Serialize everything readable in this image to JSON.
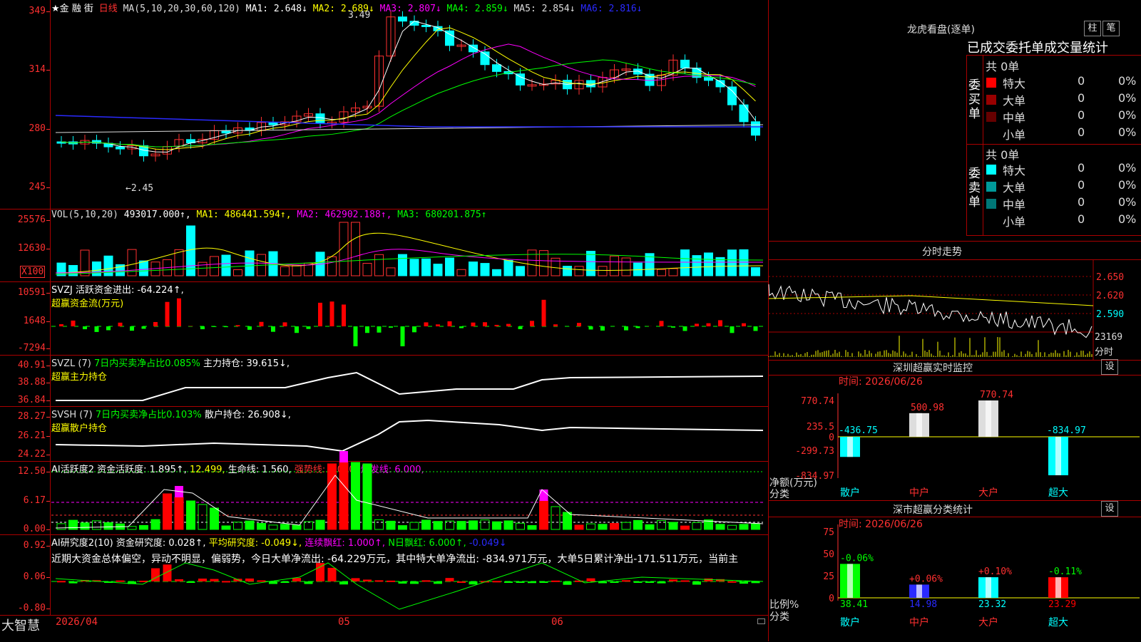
{
  "kline": {
    "stock_name": "★金 融 街",
    "period": "日线",
    "ma_label": "MA(5,10,20,30,60,120)",
    "ma": [
      {
        "label": "MA1: 2.648↓",
        "color": "#ffffff"
      },
      {
        "label": "MA2: 2.689↓",
        "color": "#ffff00"
      },
      {
        "label": "MA3: 2.807↓",
        "color": "#ff00ff"
      },
      {
        "label": "MA4: 2.859↓",
        "color": "#00ff00"
      },
      {
        "label": "MA5: 2.854↓",
        "color": "#dddddd"
      },
      {
        "label": "MA6: 2.816↓",
        "color": "#2a2aff"
      }
    ],
    "yticks": [
      "349",
      "314",
      "280",
      "245"
    ],
    "high_label": "3.49",
    "low_label": "←2.45",
    "x_labels": [
      "2026/04",
      "05",
      "06"
    ]
  },
  "volume": {
    "title": "VOL(5,10,20)",
    "value": "493017.000↑,",
    "ma1": "MA1: 486441.594↑,",
    "ma2": "MA2: 462902.188↑,",
    "ma3": "MA3: 680201.875↑",
    "yticks": [
      "25576",
      "12630"
    ],
    "unit": "X100"
  },
  "svzj": {
    "title": "SVZJ  活跃资金进出: -64.224↑,",
    "subtitle": "超赢资金流(万元)",
    "yticks": [
      "10591",
      "1648",
      "-7294"
    ]
  },
  "svzl": {
    "title": "SVZL (7)",
    "ratio": "7日内买卖净占比0.085%",
    "hold": "主力持仓: 39.615↓,",
    "subtitle": "超赢主力持仓",
    "yticks": [
      "40.91",
      "38.88",
      "36.84"
    ]
  },
  "svsh": {
    "title": "SVSH (7)",
    "ratio": "7日内买卖净占比0.103%",
    "hold": "散户持仓: 26.908↓,",
    "subtitle": "超赢散户持仓",
    "yticks": [
      "28.27",
      "26.21",
      "24.22"
    ]
  },
  "ai_active": {
    "title": "AI活跃度2 资金活跃度: 1.895↑,",
    "v2": "12.499,",
    "life": "生命线: 1.560,",
    "strong": "强势线: 3.000,",
    "burst": "爆发线: 6.000,",
    "yticks": [
      "12.50",
      "6.17",
      "0.00"
    ]
  },
  "ai_research": {
    "title": "AI研究度2(10) 资金研究度: 0.028↑,",
    "avg": "平均研究度: -0.049↓,",
    "cont": "连续飘红: 1.000↑,",
    "nday": "N日飘红: 6.000↑,",
    "last": "-0.049↓",
    "comment": "近期大资金总体偏空，异动不明显，偏弱势，今日大单净流出: -64.229万元，其中特大单净流出: -834.971万元，大单5日累计净出-171.511万元，当前主",
    "yticks": [
      "0.92",
      "0.06",
      "-0.80"
    ]
  },
  "footer": {
    "brand": "大智慧"
  },
  "lhb": {
    "title": "龙虎看盘(逐单)",
    "btn1": "柱",
    "btn2": "笔",
    "stat_title": "已成交委托单成交量统计",
    "buy_label": "委买单",
    "sell_label": "委卖单",
    "buy_total": "共 0单",
    "sell_total": "共 0单",
    "buy_rows": [
      {
        "name": "特大",
        "count": "0",
        "pct": "0%",
        "color": "#ff0000"
      },
      {
        "name": "大单",
        "count": "0",
        "pct": "0%",
        "color": "#990000"
      },
      {
        "name": "中单",
        "count": "0",
        "pct": "0%",
        "color": "#660000"
      },
      {
        "name": "小单",
        "count": "0",
        "pct": "0%",
        "color": "#000000"
      }
    ],
    "sell_rows": [
      {
        "name": "特大",
        "count": "0",
        "pct": "0%",
        "color": "#00ffff"
      },
      {
        "name": "大单",
        "count": "0",
        "pct": "0%",
        "color": "#009999"
      },
      {
        "name": "中单",
        "count": "0",
        "pct": "0%",
        "color": "#007777"
      },
      {
        "name": "小单",
        "count": "0",
        "pct": "0%",
        "color": "#000000"
      }
    ]
  },
  "intraday": {
    "title": "分时走势",
    "yticks": [
      "2.650",
      "2.620",
      "2.590"
    ],
    "vol": "23169",
    "label": "分时"
  },
  "sz_monitor": {
    "title": "深圳超赢实时监控",
    "btn": "设",
    "time": "时间: 2026/06/26",
    "yticks": [
      "770.74",
      "235.5",
      "0",
      "-299.73",
      "-834.97"
    ],
    "unit": "净额(万元)",
    "cat_label": "分类",
    "chart_data": {
      "type": "bar",
      "categories": [
        "散户",
        "中户",
        "大户",
        "超大"
      ],
      "values": [
        -436.75,
        500.98,
        770.74,
        -834.97
      ],
      "value_labels": [
        "-436.75",
        "500.98",
        "770.74",
        "-834.97"
      ],
      "ylim": [
        -834.97,
        770.74
      ]
    }
  },
  "sz_class": {
    "title": "深市超赢分类统计",
    "btn": "设",
    "time": "时间: 2026/06/26",
    "yticks": [
      "75",
      "50",
      "25",
      "0"
    ],
    "unit": "比例%",
    "cat_label": "分类",
    "chart_data": {
      "type": "bar",
      "categories": [
        "散户",
        "中户",
        "大户",
        "超大"
      ],
      "values": [
        38.41,
        14.98,
        23.32,
        23.29
      ],
      "value_labels": [
        "38.41",
        "14.98",
        "23.32",
        "23.29"
      ],
      "change_labels": [
        "-0.06%",
        "+0.06%",
        "+0.10%",
        "-0.11%"
      ],
      "ylim": [
        0,
        75
      ]
    }
  }
}
